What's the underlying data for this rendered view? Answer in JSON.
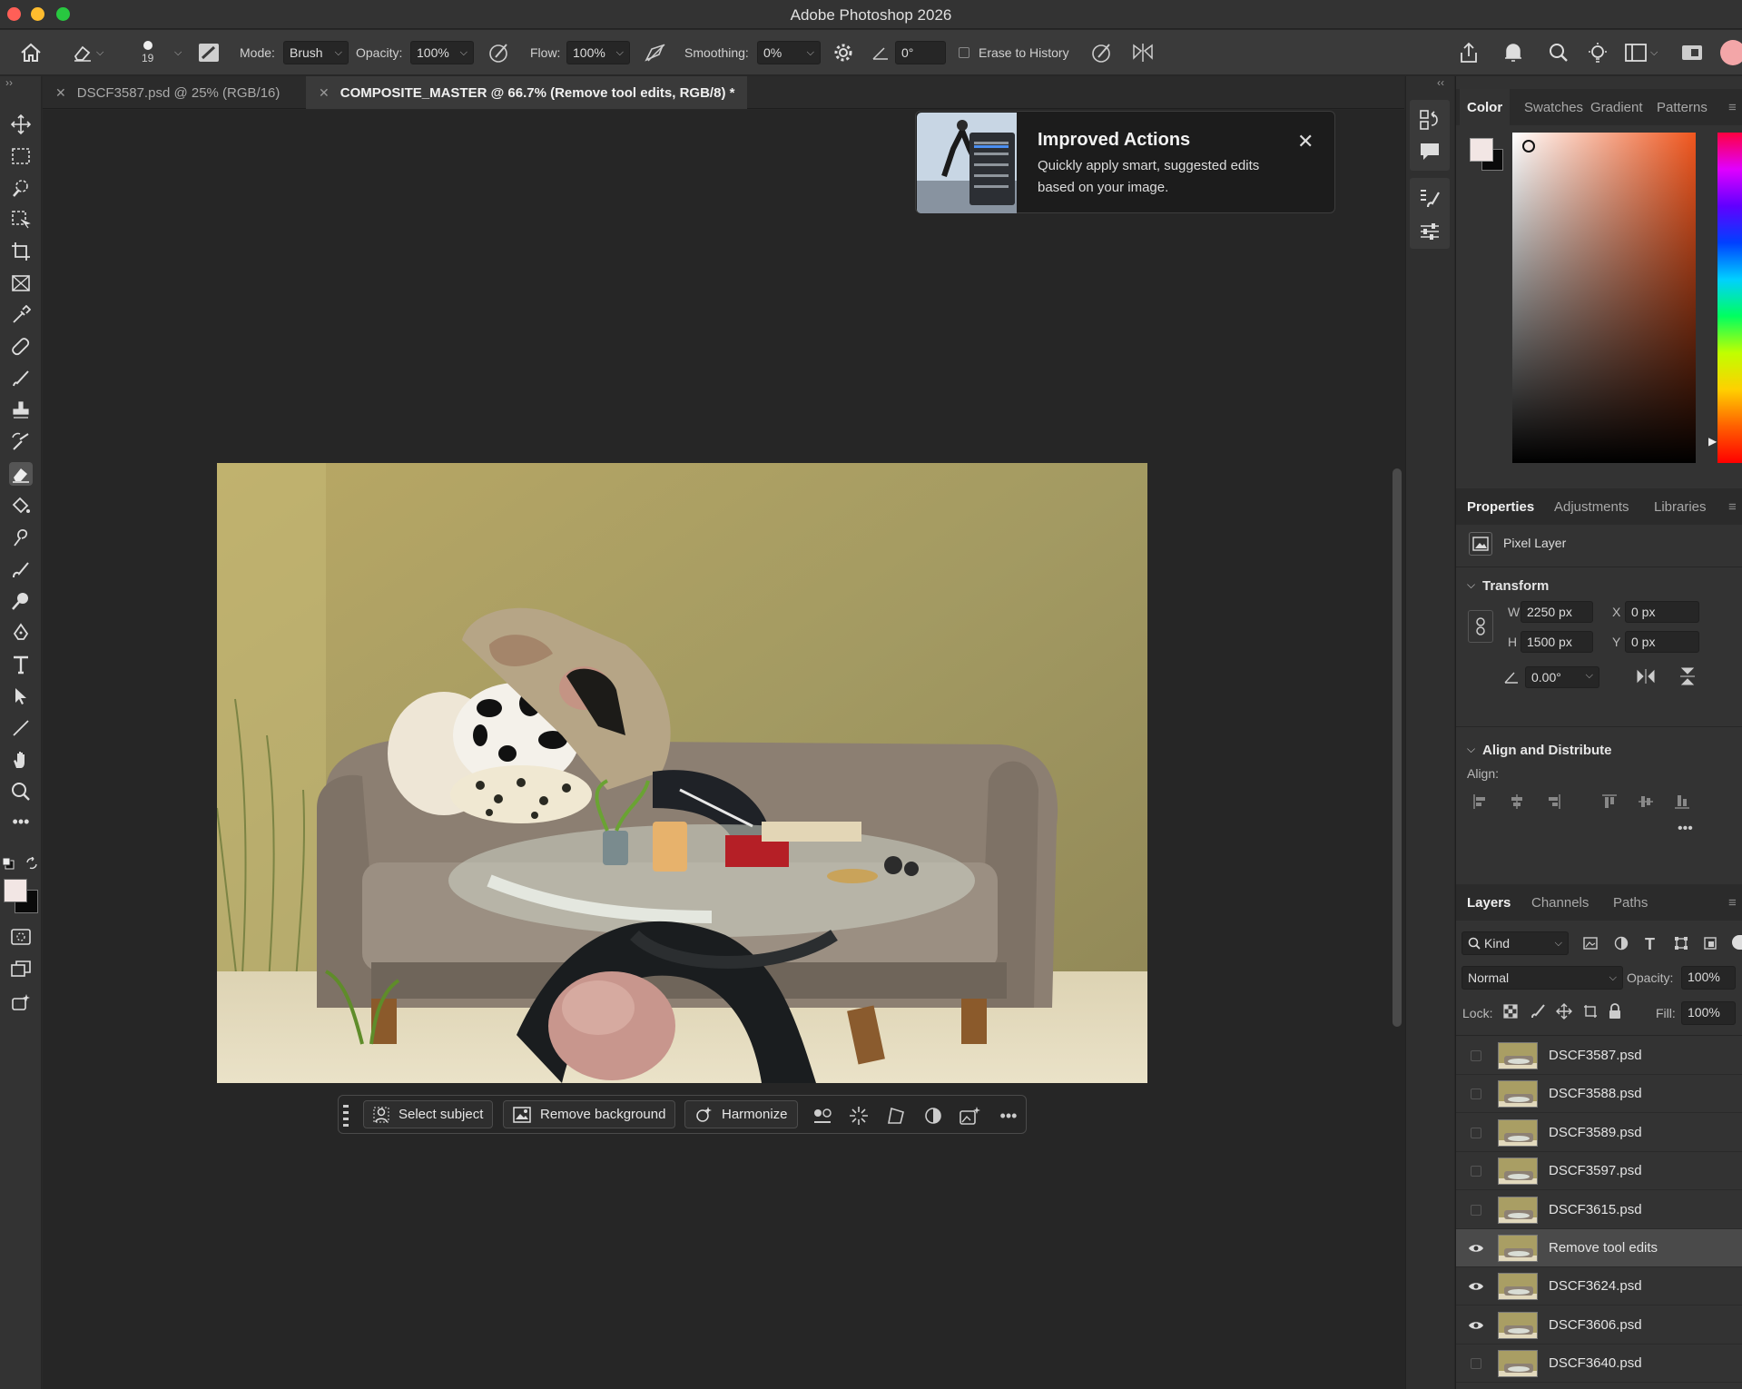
{
  "window": {
    "title": "Adobe Photoshop 2026"
  },
  "options_bar": {
    "brush_size": "19",
    "mode_label": "Mode:",
    "mode_value": "Brush",
    "opacity_label": "Opacity:",
    "opacity_value": "100%",
    "flow_label": "Flow:",
    "flow_value": "100%",
    "smoothing_label": "Smoothing:",
    "smoothing_value": "0%",
    "angle_value": "0°",
    "erase_history_label": "Erase to History"
  },
  "tabs": [
    {
      "label": "DSCF3587.psd @ 25% (RGB/16)",
      "active": false
    },
    {
      "label": "COMPOSITE_MASTER @ 66.7% (Remove tool edits, RGB/8) *",
      "active": true
    }
  ],
  "notification": {
    "title": "Improved Actions",
    "description": "Quickly apply smart, suggested edits based on your image."
  },
  "contextual_taskbar": {
    "select_subject": "Select subject",
    "remove_background": "Remove background",
    "harmonize": "Harmonize"
  },
  "color_panel": {
    "tabs": [
      "Color",
      "Swatches",
      "Gradient",
      "Patterns"
    ],
    "hue_color": "#f0561e"
  },
  "properties_panel": {
    "tabs": [
      "Properties",
      "Adjustments",
      "Libraries"
    ],
    "layer_type": "Pixel Layer",
    "transform_title": "Transform",
    "w_label": "W",
    "w_value": "2250 px",
    "h_label": "H",
    "h_value": "1500 px",
    "x_label": "X",
    "x_value": "0 px",
    "y_label": "Y",
    "y_value": "0 px",
    "angle_value": "0.00°",
    "align_title": "Align and Distribute",
    "align_label": "Align:"
  },
  "layers_panel": {
    "tabs": [
      "Layers",
      "Channels",
      "Paths"
    ],
    "filter_kind": "Kind",
    "blend_mode": "Normal",
    "opacity_label": "Opacity:",
    "opacity_value": "100%",
    "lock_label": "Lock:",
    "fill_label": "Fill:",
    "fill_value": "100%",
    "layers": [
      {
        "name": "DSCF3587.psd",
        "visible": false,
        "selected": false
      },
      {
        "name": "DSCF3588.psd",
        "visible": false,
        "selected": false
      },
      {
        "name": "DSCF3589.psd",
        "visible": false,
        "selected": false
      },
      {
        "name": "DSCF3597.psd",
        "visible": false,
        "selected": false
      },
      {
        "name": "DSCF3615.psd",
        "visible": false,
        "selected": false
      },
      {
        "name": "Remove tool edits",
        "visible": true,
        "selected": true
      },
      {
        "name": "DSCF3624.psd",
        "visible": true,
        "selected": false
      },
      {
        "name": "DSCF3606.psd",
        "visible": true,
        "selected": false
      },
      {
        "name": "DSCF3640.psd",
        "visible": false,
        "selected": false
      }
    ]
  }
}
